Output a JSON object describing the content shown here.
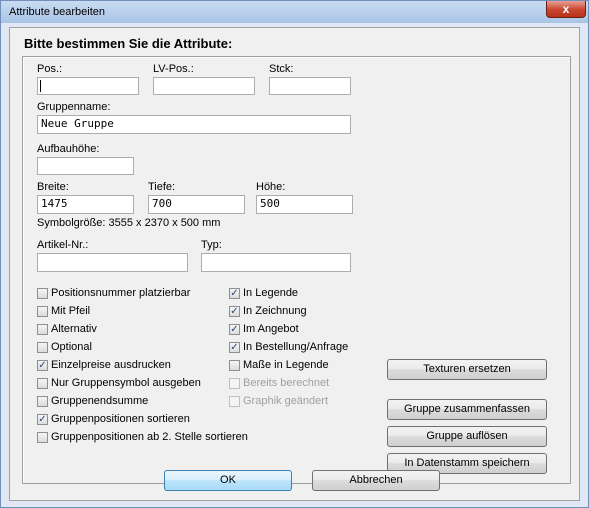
{
  "window": {
    "title": "Attribute bearbeiten",
    "close_label": "x"
  },
  "heading": "Bitte bestimmen Sie die Attribute:",
  "fields": {
    "pos": {
      "label": "Pos.:",
      "value": ""
    },
    "lv_pos": {
      "label": "LV-Pos.:",
      "value": ""
    },
    "stck": {
      "label": "Stck:",
      "value": ""
    },
    "gruppenname": {
      "label": "Gruppenname:",
      "value": "Neue Gruppe"
    },
    "aufbauhoehe": {
      "label": "Aufbauhöhe:",
      "value": ""
    },
    "breite": {
      "label": "Breite:",
      "value": "1475"
    },
    "tiefe": {
      "label": "Tiefe:",
      "value": "700"
    },
    "hoehe": {
      "label": "Höhe:",
      "value": "500"
    },
    "artikel_nr": {
      "label": "Artikel-Nr.:",
      "value": ""
    },
    "typ": {
      "label": "Typ:",
      "value": ""
    }
  },
  "symbol_size": "Symbolgröße: 3555 x 2370 x 500 mm",
  "checkboxes_left": [
    {
      "label": "Positionsnummer platzierbar",
      "checked": false,
      "enabled": true
    },
    {
      "label": "Mit Pfeil",
      "checked": false,
      "enabled": true
    },
    {
      "label": "Alternativ",
      "checked": false,
      "enabled": true
    },
    {
      "label": "Optional",
      "checked": false,
      "enabled": true
    },
    {
      "label": "Einzelpreise ausdrucken",
      "checked": true,
      "enabled": true
    },
    {
      "label": "Nur Gruppensymbol ausgeben",
      "checked": false,
      "enabled": true
    },
    {
      "label": "Gruppenendsumme",
      "checked": false,
      "enabled": true
    },
    {
      "label": "Gruppenpositionen sortieren",
      "checked": true,
      "enabled": true
    },
    {
      "label": "Gruppenpositionen ab 2. Stelle sortieren",
      "checked": false,
      "enabled": true
    }
  ],
  "checkboxes_right": [
    {
      "label": "In Legende",
      "checked": true,
      "enabled": true
    },
    {
      "label": "In Zeichnung",
      "checked": true,
      "enabled": true
    },
    {
      "label": "Im Angebot",
      "checked": true,
      "enabled": true
    },
    {
      "label": "In Bestellung/Anfrage",
      "checked": true,
      "enabled": true
    },
    {
      "label": "Maße in Legende",
      "checked": false,
      "enabled": true
    },
    {
      "label": "Bereits berechnet",
      "checked": false,
      "enabled": false
    },
    {
      "label": "Graphik geändert",
      "checked": false,
      "enabled": false
    }
  ],
  "buttons": {
    "texturen_ersetzen": "Texturen ersetzen",
    "gruppe_zusammenfassen": "Gruppe zusammenfassen",
    "gruppe_aufloesen": "Gruppe auflösen",
    "in_datenstamm_speichern": "In Datenstamm speichern",
    "ok": "OK",
    "abbrechen": "Abbrechen"
  }
}
